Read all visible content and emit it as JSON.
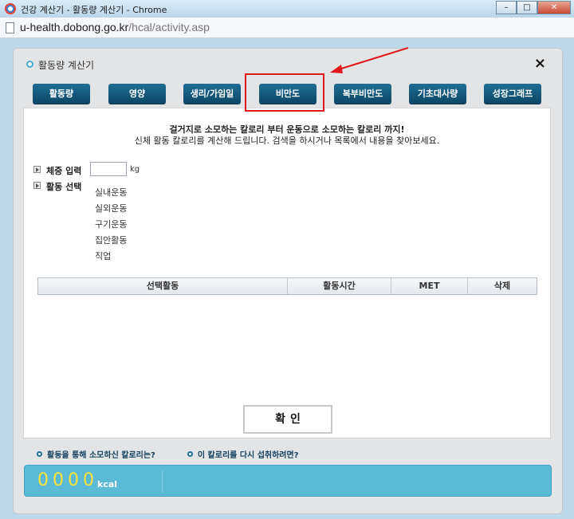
{
  "window": {
    "title": "건강 계산기 - 활동량 계산기 - Chrome",
    "url_host": "u-health.dobong.go.kr",
    "url_path": "/hcal/activity.asp"
  },
  "dialog": {
    "title": "활동량 계산기",
    "close_label": "×"
  },
  "tabs": [
    {
      "label": "활동량"
    },
    {
      "label": "영양"
    },
    {
      "label": "생리/가임일"
    },
    {
      "label": "비만도"
    },
    {
      "label": "복부비만도"
    },
    {
      "label": "기초대사량"
    },
    {
      "label": "성장그래프"
    }
  ],
  "panel": {
    "intro_line1": "걸거지로 소모하는 칼로리 부터 운동으로 소모하는 칼로리 까지!",
    "intro_line2": "신체 활동 칼로리를 계산해 드립니다. 검색을 하시거나 목록에서 내용을 찾아보세요.",
    "weight_label": "체중 입력",
    "weight_value": "",
    "weight_unit": "kg",
    "activity_label": "활동 선택",
    "activities": [
      "실내운동",
      "실외운동",
      "구기운동",
      "집안활동",
      "직업"
    ],
    "table_headers": [
      "선택활동",
      "활동시간",
      "MET",
      "삭제"
    ],
    "confirm_label": "확인"
  },
  "questions": [
    "활동을 통해 소모하신 칼로리는?",
    "이 칼로리를 다시 섭취하려면?"
  ],
  "result": {
    "value": "0000",
    "unit": "kcal",
    "digit_color": "#f7e23b"
  },
  "colors": {
    "tab_bg": "#0c4766",
    "highlight": "#e0181b",
    "result_bg": "#5bbad6"
  }
}
